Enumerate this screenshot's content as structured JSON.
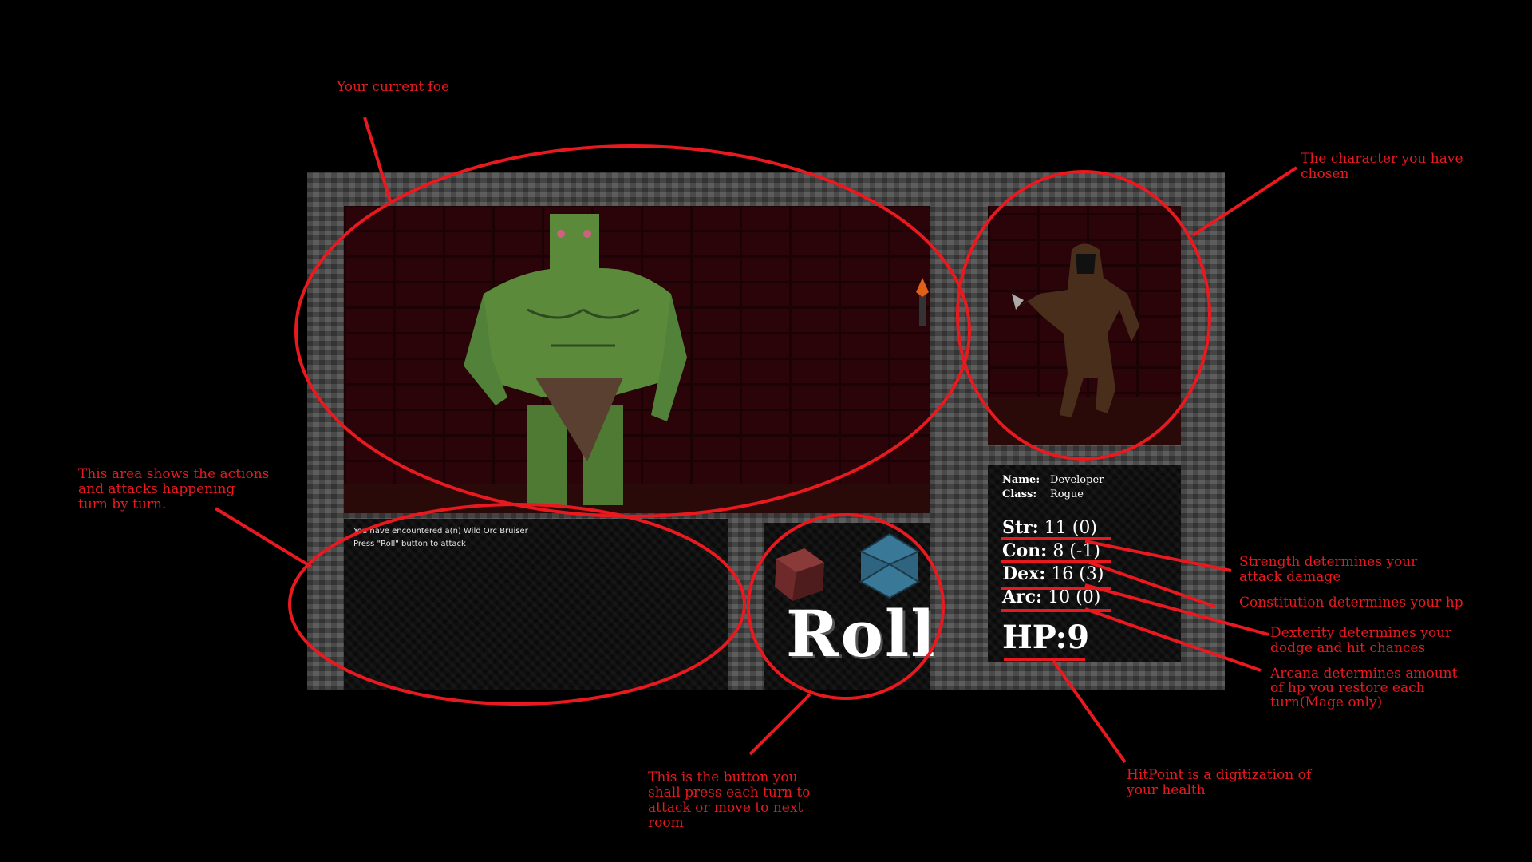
{
  "annotations": {
    "foe": "Your current foe",
    "character_line1": "The character you have",
    "character_line2": "chosen",
    "log_line1": "This area shows the actions",
    "log_line2": "and attacks happening",
    "log_line3": "turn by turn.",
    "roll_line1": "This is the button you",
    "roll_line2": "shall press each turn to",
    "roll_line3": "attack or move to next",
    "roll_line4": "room",
    "str_line1": "Strength determines your",
    "str_line2": "attack damage",
    "con": "Constitution determines your hp",
    "dex_line1": "Dexterity determines your",
    "dex_line2": "dodge and hit chances",
    "arc_line1": "Arcana determines amount",
    "arc_line2": "of hp you restore each",
    "arc_line3": "turn(Mage only)",
    "hp_line1": "HitPoint is a digitization of",
    "hp_line2": "your health"
  },
  "log": {
    "line1": "You have encountered a(n) Wild Orc Bruiser",
    "line2": "Press \"Roll\" button to attack"
  },
  "roll_button": {
    "label": "Roll"
  },
  "character": {
    "name_label": "Name:",
    "name": "Developer",
    "class_label": "Class:",
    "class": "Rogue"
  },
  "stats": {
    "str_label": "Str:",
    "str_value": "11 (0)",
    "con_label": "Con:",
    "con_value": "8 (-1)",
    "dex_label": "Dex:",
    "dex_value": "16 (3)",
    "arc_label": "Arc:",
    "arc_value": "10 (0)",
    "hp": "HP:9"
  },
  "colors": {
    "annotation": "#e8191f",
    "wall": "#2a0409",
    "orc": "#5a8a3a"
  }
}
